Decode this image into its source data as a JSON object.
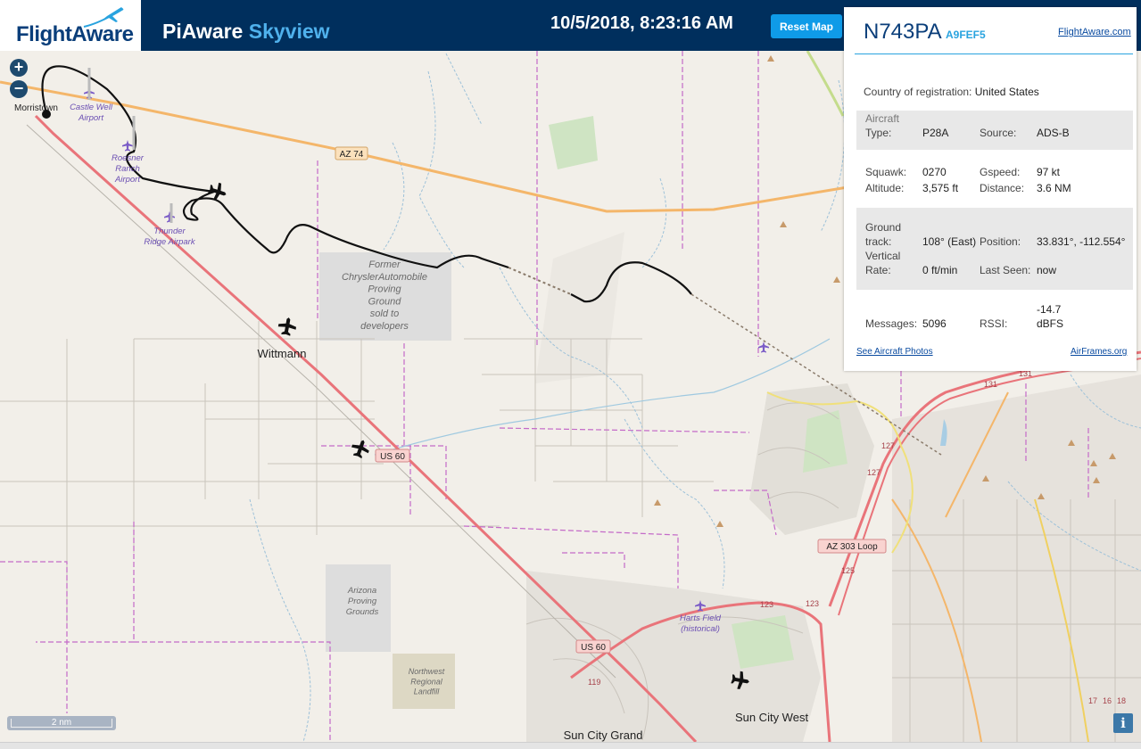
{
  "header": {
    "logo_text": "FlightAware",
    "title_main": "PiAware",
    "title_accent": "Skyview",
    "clock": "10/5/2018, 8:23:16 AM",
    "reset_label": "Reset Map"
  },
  "colors": {
    "header_bg": "#002f5d",
    "accent": "#29a3df",
    "button": "#0f9be8",
    "highway": "#f4b66a",
    "freeway": "#e9747a",
    "track": "#111111"
  },
  "map": {
    "labels": {
      "morristown": "Morristown",
      "castle_well": "Castle Well\nAirport",
      "roesner": "Roesner\nRanch\nAirport",
      "thunder": "Thunder\nRidge Airpark",
      "az74": "AZ 74",
      "chrysler": "Former\nChryslerAutomobile\nProving\nGround\nsold to\ndevelopers",
      "wittmann": "Wittmann",
      "us60a": "US 60",
      "us60b": "US 60",
      "arizona_pg": "Arizona\nProving\nGrounds",
      "landfill": "Northwest\nRegional\nLandfill",
      "az303": "AZ 303 Loop",
      "harts": "Harts Field\n(historical)",
      "sun_city_west": "Sun City West",
      "sun_city_grand": "Sun City Grand",
      "n131a": "131",
      "n131b": "131",
      "n127a": "127",
      "n127b": "127",
      "n125": "125",
      "n123a": "123",
      "n123b": "123",
      "n119": "119",
      "n17": "17",
      "n16": "16",
      "n18": "18"
    },
    "scale_label": "2 nm",
    "zoom_in": "+",
    "zoom_out": "−",
    "info": "i"
  },
  "panel": {
    "registration": "N743PA",
    "hex": "A9FEF5",
    "fa_link": "FlightAware.com",
    "country_label": "Country of registration:",
    "country": "United States",
    "type_label1": "Aircraft",
    "type_label2": "Type:",
    "type": "P28A",
    "source_label": "Source:",
    "source": "ADS-B",
    "squawk_label": "Squawk:",
    "squawk": "0270",
    "gspeed_label": "Gspeed:",
    "gspeed": "97 kt",
    "altitude_label": "Altitude:",
    "altitude": "3,575 ft",
    "distance_label": "Distance:",
    "distance": "3.6 NM",
    "track_label1": "Ground",
    "track_label2": "track:",
    "track": "108° (East)",
    "position_label": "Position:",
    "position": "33.831°, -112.554°",
    "vrate_label1": "Vertical",
    "vrate_label2": "Rate:",
    "vrate": "0 ft/min",
    "lastseen_label": "Last Seen:",
    "lastseen": "now",
    "messages_label": "Messages:",
    "messages": "5096",
    "rssi_label": "RSSI:",
    "rssi1": "-14.7",
    "rssi2": "dBFS",
    "photos_link": "See Aircraft Photos",
    "airframes_link": "AirFrames.org"
  }
}
